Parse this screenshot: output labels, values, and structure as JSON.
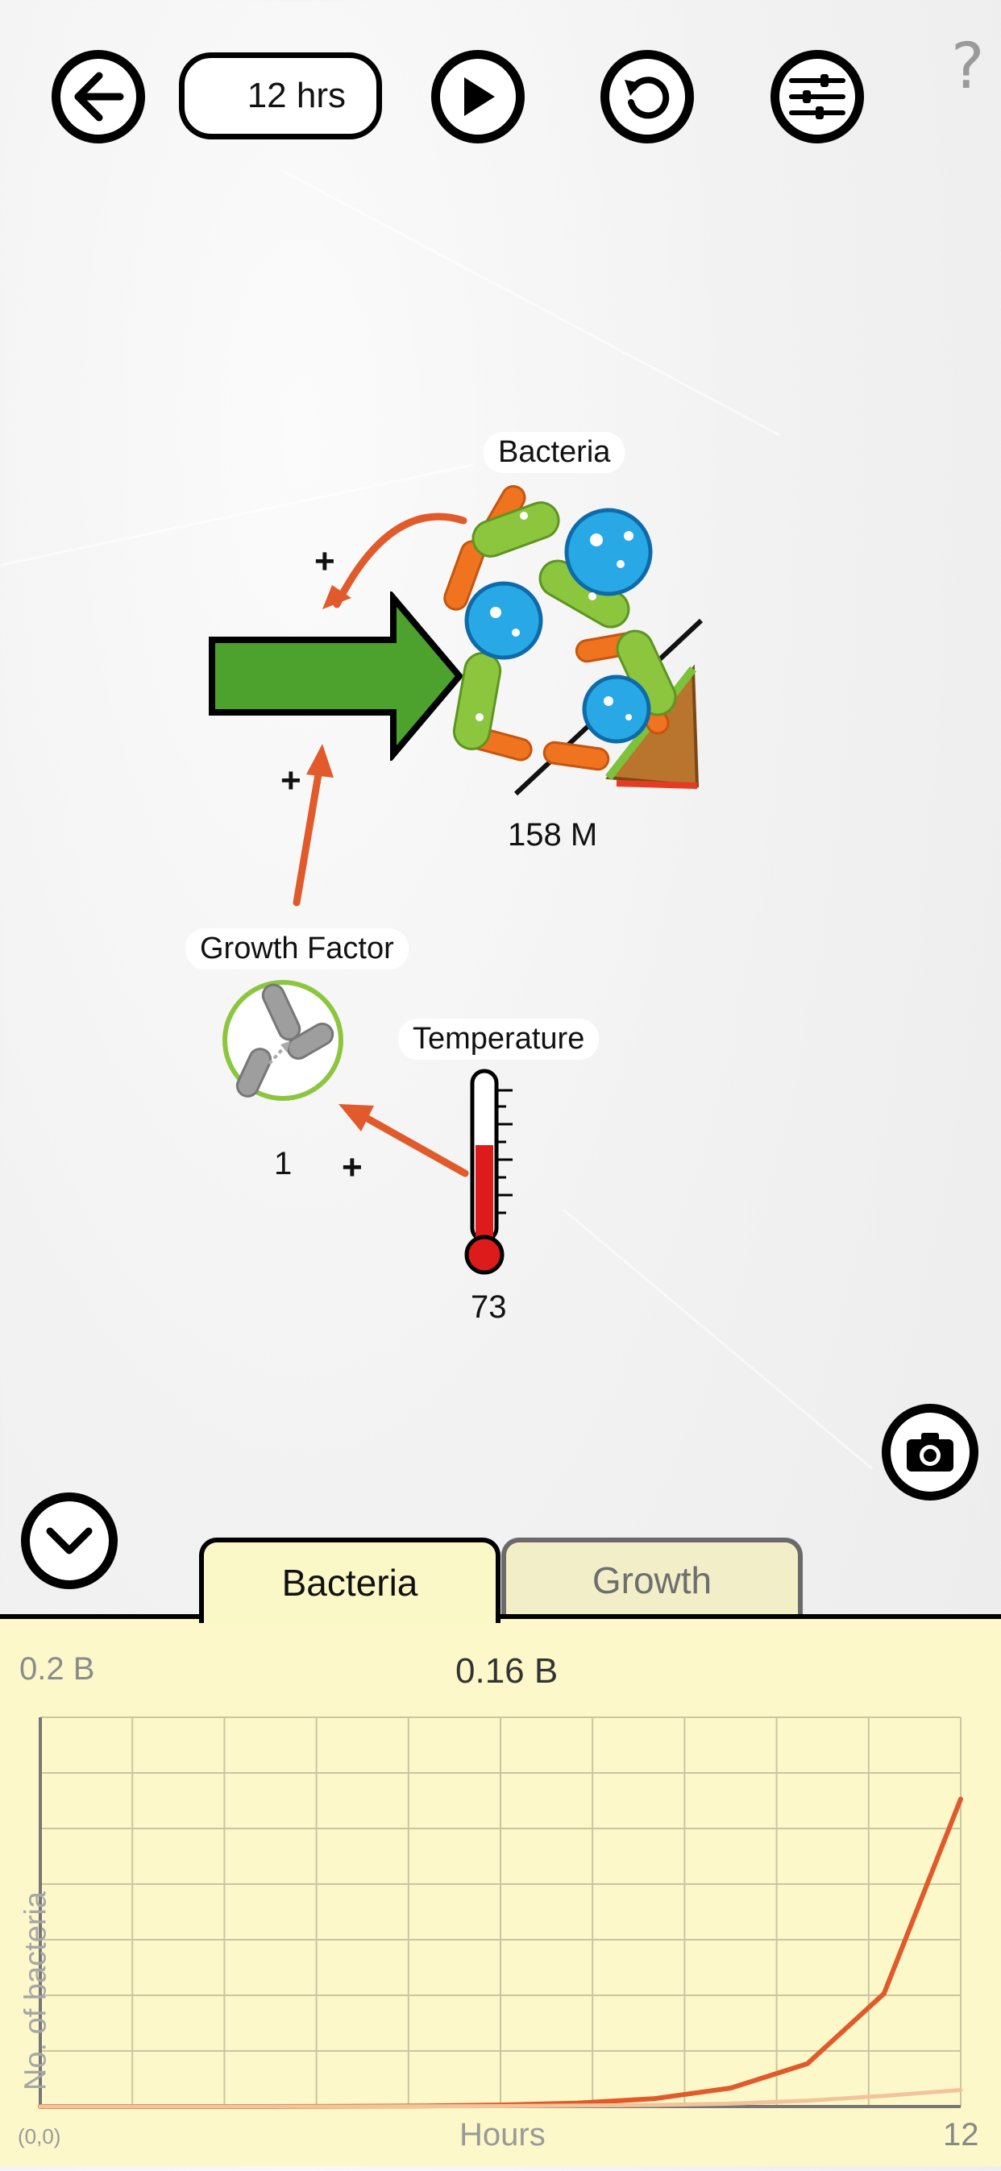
{
  "toolbar": {
    "time_value": "12 hrs",
    "help_label": "?"
  },
  "diagram": {
    "bacteria_label": "Bacteria",
    "bacteria_value": "158 M",
    "growth_factor_label": "Growth Factor",
    "growth_factor_value": "1",
    "temperature_label": "Temperature",
    "temperature_value": "73",
    "plus_sign": "+"
  },
  "graph_panel": {
    "tabs": [
      {
        "label": "Bacteria",
        "active": true
      },
      {
        "label": "Growth",
        "active": false
      }
    ],
    "y_max_label": "0.2 B",
    "current_value": "0.16 B",
    "y_axis_label": "No. of bacteria",
    "x_axis_label": "Hours",
    "origin_label": "(0,0)",
    "x_max_label": "12"
  },
  "chart_data": {
    "type": "line",
    "xlabel": "Hours",
    "ylabel": "No. of bacteria",
    "xlim": [
      0,
      12
    ],
    "ylim": [
      0,
      0.2
    ],
    "grid": true,
    "series": [
      {
        "color": "#e05a2b",
        "x": [
          0,
          1,
          2,
          3,
          4,
          5,
          6,
          7,
          8,
          9,
          10,
          11,
          12
        ],
        "y": [
          0,
          0,
          0,
          0,
          0.0001,
          0.0003,
          0.0008,
          0.0018,
          0.004,
          0.0095,
          0.022,
          0.058,
          0.158
        ]
      },
      {
        "color": "#f1c49a",
        "x": [
          0,
          2,
          4,
          6,
          8,
          9,
          10,
          11,
          12
        ],
        "y": [
          0,
          0,
          0,
          0.0002,
          0.0008,
          0.0015,
          0.003,
          0.0055,
          0.0085
        ]
      }
    ]
  },
  "colors": {
    "accent_orange": "#e05a2b",
    "arrow_green": "#4ca22c",
    "panel_yellow": "#fcf8c9",
    "thermometer_red": "#dd1b1b"
  }
}
